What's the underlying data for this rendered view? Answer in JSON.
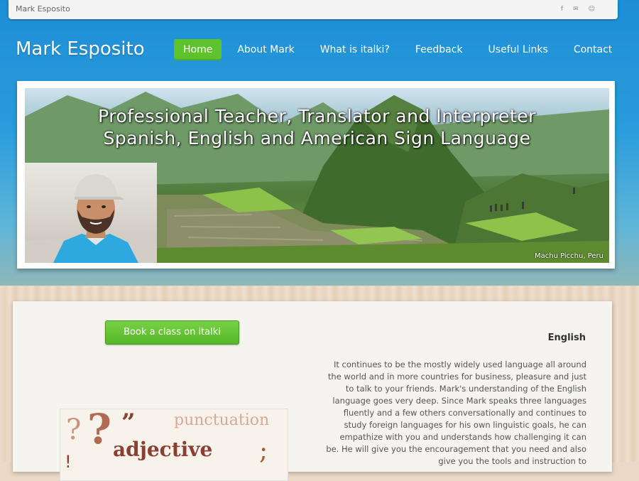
{
  "topbar": {
    "site_name": "Mark Esposito",
    "social_icons": [
      "facebook-icon",
      "email-icon",
      "users-icon"
    ]
  },
  "header": {
    "brand": "Mark Esposito",
    "nav": [
      {
        "label": "Home",
        "active": true
      },
      {
        "label": "About Mark",
        "active": false
      },
      {
        "label": "What is italki?",
        "active": false
      },
      {
        "label": "Feedback",
        "active": false
      },
      {
        "label": "Useful Links",
        "active": false
      },
      {
        "label": "Contact",
        "active": false
      }
    ]
  },
  "hero": {
    "headline_line1": "Professional Teacher, Translator and Interpreter",
    "headline_line2": "Spanish, English and American Sign Language",
    "photo_caption": "Machu Picchu, Peru"
  },
  "content": {
    "book_button": "Book a class on italki",
    "section_title": "English",
    "section_text": "It continues to be the mostly widely used language all around the world and in more countries for business, pleasure and just to talk to your friends.  Mark's understanding of the English language goes very deep.  Since Mark speaks three languages fluently and a few others conversationally and continues to study foreign languages for his own linguistic goals, he can empathize with you and understands how challenging it can be. He will give you the encouragement that you need and also give you the tools and instruction to",
    "grammar_image_words": [
      "punctuation",
      "adjective"
    ]
  },
  "colors": {
    "accent_green": "#5ec32b",
    "sky_blue": "#1d8ed6"
  }
}
